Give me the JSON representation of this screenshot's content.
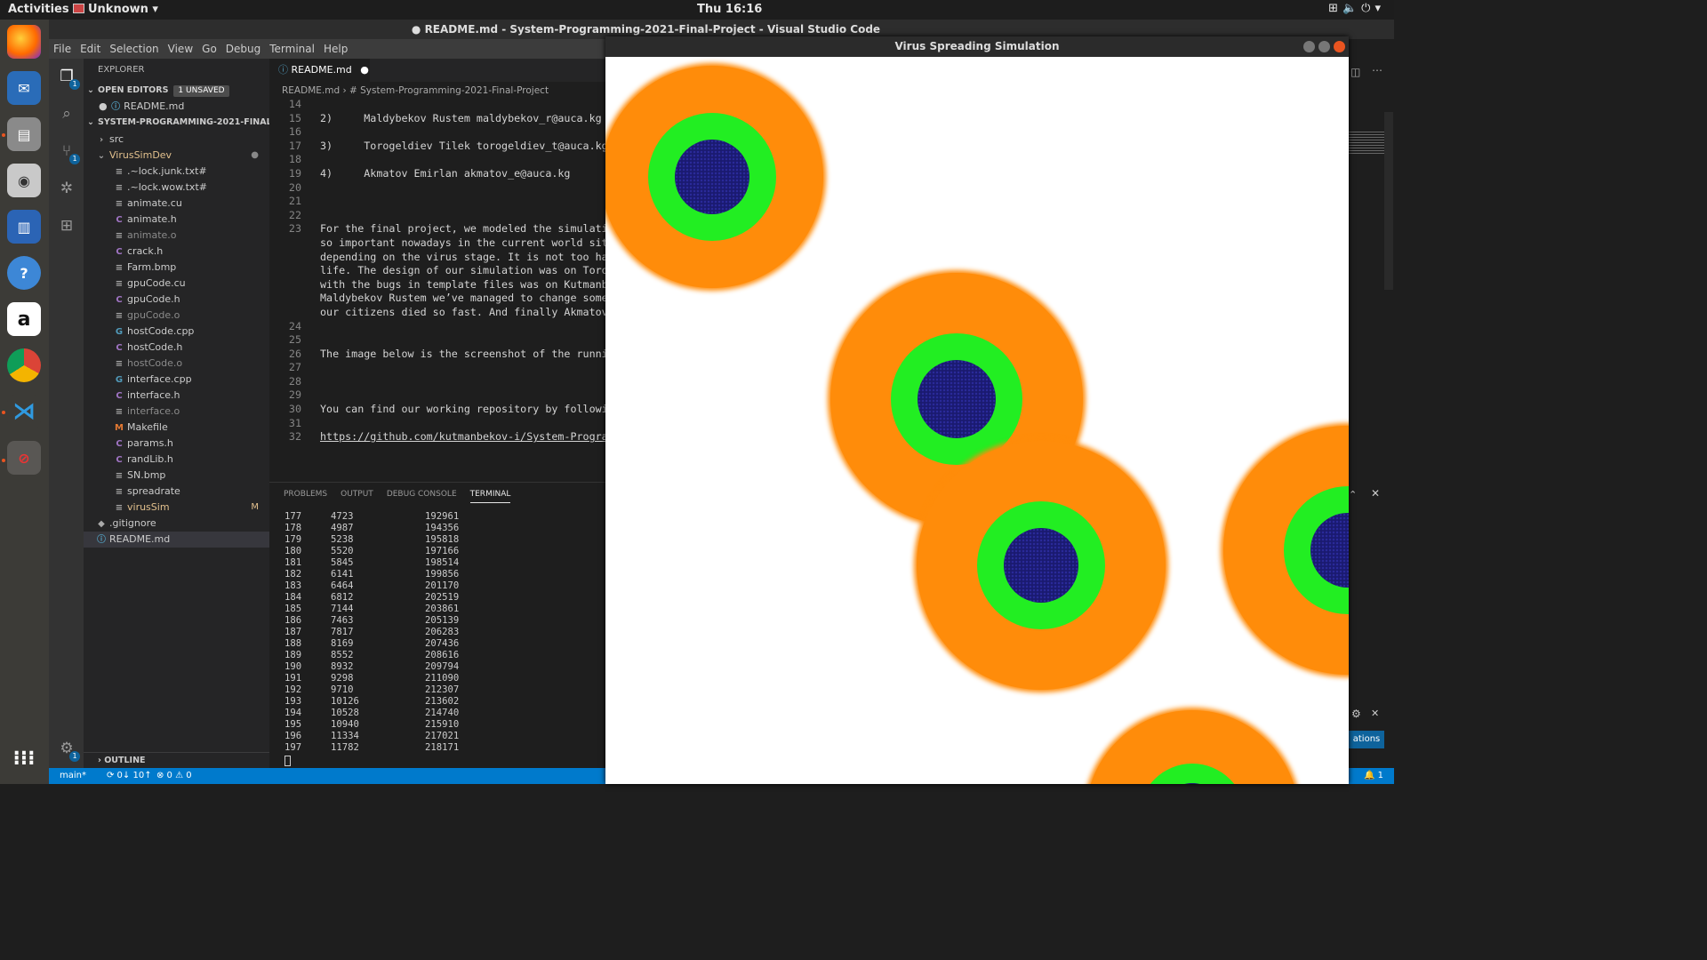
{
  "topbar": {
    "activities": "Activities",
    "app_menu": "Unknown ▾",
    "clock": "Thu 16:16"
  },
  "vscode": {
    "window_title": "● README.md - System-Programming-2021-Final-Project - Visual Studio Code",
    "menu": [
      "File",
      "Edit",
      "Selection",
      "View",
      "Go",
      "Debug",
      "Terminal",
      "Help"
    ],
    "explorer": {
      "header": "EXPLORER",
      "open_editors": "OPEN EDITORS",
      "unsaved": "1 UNSAVED",
      "open_file": "README.md",
      "project": "SYSTEM-PROGRAMMING-2021-FINAL-PRO...",
      "files": [
        {
          "name": "src",
          "icon": "›",
          "color": "#ccc"
        },
        {
          "name": "VirusSimDev",
          "icon": "⌄",
          "color": "#e2c08d"
        },
        {
          "name": ".~lock.junk.txt#",
          "icon": "≡",
          "color": "#ccc"
        },
        {
          "name": ".~lock.wow.txt#",
          "icon": "≡",
          "color": "#ccc"
        },
        {
          "name": "animate.cu",
          "icon": "≡",
          "color": "#ccc"
        },
        {
          "name": "animate.h",
          "icon": "C",
          "color": "#ccc"
        },
        {
          "name": "animate.o",
          "icon": "≡",
          "color": "#8b8b8b"
        },
        {
          "name": "crack.h",
          "icon": "C",
          "color": "#ccc"
        },
        {
          "name": "Farm.bmp",
          "icon": "≡",
          "color": "#ccc"
        },
        {
          "name": "gpuCode.cu",
          "icon": "≡",
          "color": "#ccc"
        },
        {
          "name": "gpuCode.h",
          "icon": "C",
          "color": "#ccc"
        },
        {
          "name": "gpuCode.o",
          "icon": "≡",
          "color": "#8b8b8b"
        },
        {
          "name": "hostCode.cpp",
          "icon": "G",
          "color": "#ccc"
        },
        {
          "name": "hostCode.h",
          "icon": "C",
          "color": "#ccc"
        },
        {
          "name": "hostCode.o",
          "icon": "≡",
          "color": "#8b8b8b"
        },
        {
          "name": "interface.cpp",
          "icon": "G",
          "color": "#ccc"
        },
        {
          "name": "interface.h",
          "icon": "C",
          "color": "#ccc"
        },
        {
          "name": "interface.o",
          "icon": "≡",
          "color": "#8b8b8b"
        },
        {
          "name": "Makefile",
          "icon": "M",
          "color": "#ccc"
        },
        {
          "name": "params.h",
          "icon": "C",
          "color": "#ccc"
        },
        {
          "name": "randLib.h",
          "icon": "C",
          "color": "#ccc"
        },
        {
          "name": "SN.bmp",
          "icon": "≡",
          "color": "#ccc"
        },
        {
          "name": "spreadrate",
          "icon": "≡",
          "color": "#ccc"
        },
        {
          "name": "virusSim",
          "icon": "≡",
          "color": "#e2c08d",
          "mark": "M"
        },
        {
          "name": ".gitignore",
          "icon": "◆",
          "color": "#ccc"
        },
        {
          "name": "README.md",
          "icon": "ⓘ",
          "color": "#ccc"
        }
      ],
      "outline": "OUTLINE"
    },
    "tab": "README.md",
    "breadcrumb": "README.md  ›  # System-Programming-2021-Final-Project",
    "code_lines": [
      {
        "n": "14",
        "t": ""
      },
      {
        "n": "15",
        "t": "2)     Maldybekov Rustem maldybekov_r@auca.kg"
      },
      {
        "n": "16",
        "t": ""
      },
      {
        "n": "17",
        "t": "3)     Torogeldiev Tilek torogeldiev_t@auca.kg"
      },
      {
        "n": "18",
        "t": ""
      },
      {
        "n": "19",
        "t": "4)     Akmatov Emirlan akmatov_e@auca.kg"
      },
      {
        "n": "20",
        "t": ""
      },
      {
        "n": "21",
        "t": ""
      },
      {
        "n": "22",
        "t": ""
      },
      {
        "n": "23",
        "t": "For the final project, we modeled the simulatio"
      },
      {
        "n": "",
        "t": "so important nowadays in the current world situ"
      },
      {
        "n": "",
        "t": "depending on the virus stage. It is not too har"
      },
      {
        "n": "",
        "t": "life. The design of our simulation was on Torog"
      },
      {
        "n": "",
        "t": "with the bugs in template files was on Kutmanbe"
      },
      {
        "n": "",
        "t": "Maldybekov Rustem we’ve managed to change some"
      },
      {
        "n": "",
        "t": "our citizens died so fast. And finally Akmatov"
      },
      {
        "n": "24",
        "t": ""
      },
      {
        "n": "25",
        "t": ""
      },
      {
        "n": "26",
        "t": "The image below is the screenshot of the runnin"
      },
      {
        "n": "27",
        "t": ""
      },
      {
        "n": "28",
        "t": ""
      },
      {
        "n": "29",
        "t": ""
      },
      {
        "n": "30",
        "t": "You can find our working repository by followin"
      },
      {
        "n": "31",
        "t": ""
      },
      {
        "n": "32",
        "t": "https://github.com/kutmanbekov-i/System-Program"
      }
    ],
    "panel_tabs": [
      "PROBLEMS",
      "OUTPUT",
      "DEBUG CONSOLE",
      "TERMINAL"
    ],
    "terminal_rows": [
      [
        "177",
        "4723",
        "192961"
      ],
      [
        "178",
        "4987",
        "194356"
      ],
      [
        "179",
        "5238",
        "195818"
      ],
      [
        "180",
        "5520",
        "197166"
      ],
      [
        "181",
        "5845",
        "198514"
      ],
      [
        "182",
        "6141",
        "199856"
      ],
      [
        "183",
        "6464",
        "201170"
      ],
      [
        "184",
        "6812",
        "202519"
      ],
      [
        "185",
        "7144",
        "203861"
      ],
      [
        "186",
        "7463",
        "205139"
      ],
      [
        "187",
        "7817",
        "206283"
      ],
      [
        "188",
        "8169",
        "207436"
      ],
      [
        "189",
        "8552",
        "208616"
      ],
      [
        "190",
        "8932",
        "209794"
      ],
      [
        "191",
        "9298",
        "211090"
      ],
      [
        "192",
        "9710",
        "212307"
      ],
      [
        "193",
        "10126",
        "213602"
      ],
      [
        "194",
        "10528",
        "214740"
      ],
      [
        "195",
        "10940",
        "215910"
      ],
      [
        "196",
        "11334",
        "217021"
      ],
      [
        "197",
        "11782",
        "218171"
      ]
    ],
    "status": {
      "branch": "main*",
      "sync": "⟳ 0↓ 10↑",
      "problems": "⊗ 0 ⚠ 0",
      "bell": "🔔 1"
    },
    "notification_button": "ations"
  },
  "sim": {
    "title": "Virus Spreading Simulation",
    "colors": {
      "susceptible": "#ffffff",
      "infected": "#ff8c0a",
      "dying": "#22ee22",
      "dead": "#1a1a70"
    }
  }
}
